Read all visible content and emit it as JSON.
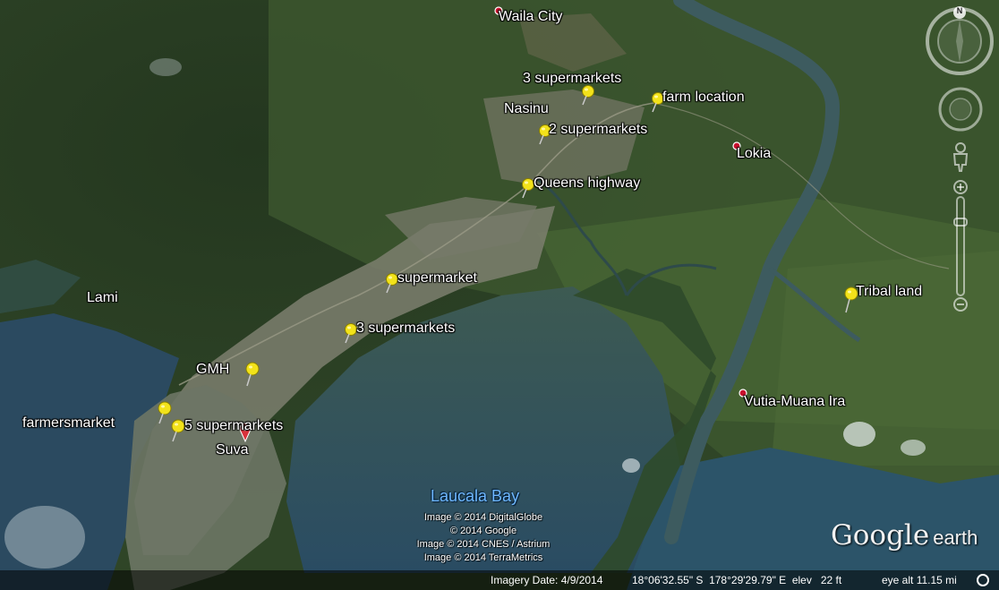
{
  "places": {
    "waila_city": "Waila City",
    "nasinu": "Nasinu",
    "lokia": "Lokia",
    "lami": "Lami",
    "suva": "Suva",
    "vutia_muana_ira": "Vutia-Muana Ira",
    "laucala_bay": "Laucala Bay"
  },
  "placemarks": {
    "three_supermarkets_north": "3 supermarkets",
    "farm_location": "farm location",
    "two_supermarkets": "2 supermarkets",
    "queens_highway": "Queens highway",
    "supermarket": "supermarket",
    "three_supermarkets_south": "3 supermarkets",
    "gmh": "GMH",
    "farmersmarket": "farmersmarket",
    "five_supermarkets": "5 supermarkets",
    "tribal_land": "Tribal land"
  },
  "credits": [
    "Image © 2014 DigitalGlobe",
    "© 2014 Google",
    "Image © 2014 CNES / Astrium",
    "Image © 2014 TerraMetrics"
  ],
  "logo": {
    "google": "Google",
    "earth": "earth"
  },
  "status": {
    "imagery_date": "Imagery Date: 4/9/2014",
    "coords": "18°06'32.55\" S  178°29'29.79\" E  elev   22 ft",
    "eye_alt": "eye alt  11.15 mi"
  },
  "nav": {
    "north": "N"
  },
  "colors": {
    "pin": "#f2e21a",
    "place_marker": "#c8102e",
    "water_label": "#6fb8ff"
  },
  "icons": [
    "pushpin-icon",
    "red-dot-marker-icon",
    "red-balloon-icon",
    "compass-icon",
    "look-joystick-icon",
    "street-view-icon",
    "zoom-slider-icon"
  ]
}
